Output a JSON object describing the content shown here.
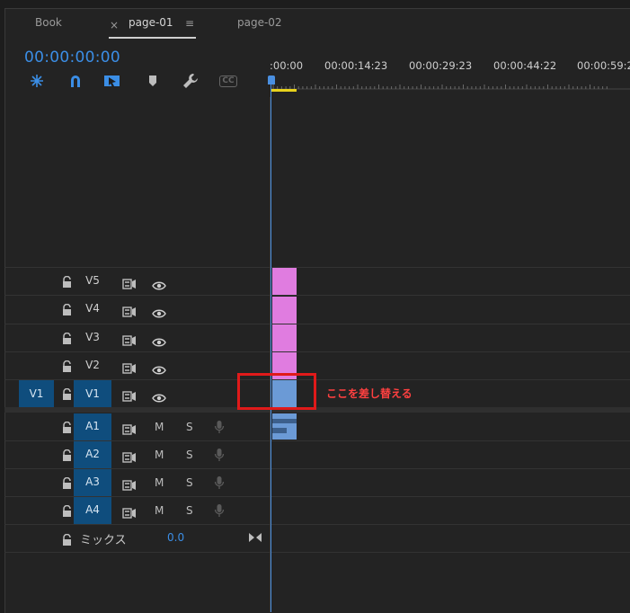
{
  "tabs": {
    "book": "Book",
    "page01": "page-01",
    "page02": "page-02",
    "close": "×",
    "menu": "≡"
  },
  "timecode": "00:00:00:00",
  "toolbar": [
    "ripple-insert-icon",
    "snap-magnet-icon",
    "linked-selection-icon",
    "marker-icon",
    "wrench-icon",
    "captions-icon"
  ],
  "captions_label": "CC",
  "ruler": [
    ":00:00",
    "00:00:14:23",
    "00:00:29:23",
    "00:00:44:22",
    "00:00:59:2"
  ],
  "video_tracks": [
    {
      "name": "V5"
    },
    {
      "name": "V4"
    },
    {
      "name": "V3"
    },
    {
      "name": "V2"
    },
    {
      "name": "V1",
      "targeted": true
    }
  ],
  "source_patch": "V1",
  "audio_tracks": [
    {
      "name": "A1",
      "m": "M",
      "s": "S"
    },
    {
      "name": "A2",
      "m": "M",
      "s": "S"
    },
    {
      "name": "A3",
      "m": "M",
      "s": "S"
    },
    {
      "name": "A4",
      "m": "M",
      "s": "S"
    }
  ],
  "mix": {
    "label": "ミックス",
    "value": "0.0"
  },
  "annotation": "ここを差し替える",
  "colors": {
    "accent": "#3b8ee6",
    "clip_video": "#e07ce0",
    "clip_v1": "#6b9ad6",
    "highlight": "#e01a1a",
    "track_target": "#0f4d7d"
  }
}
